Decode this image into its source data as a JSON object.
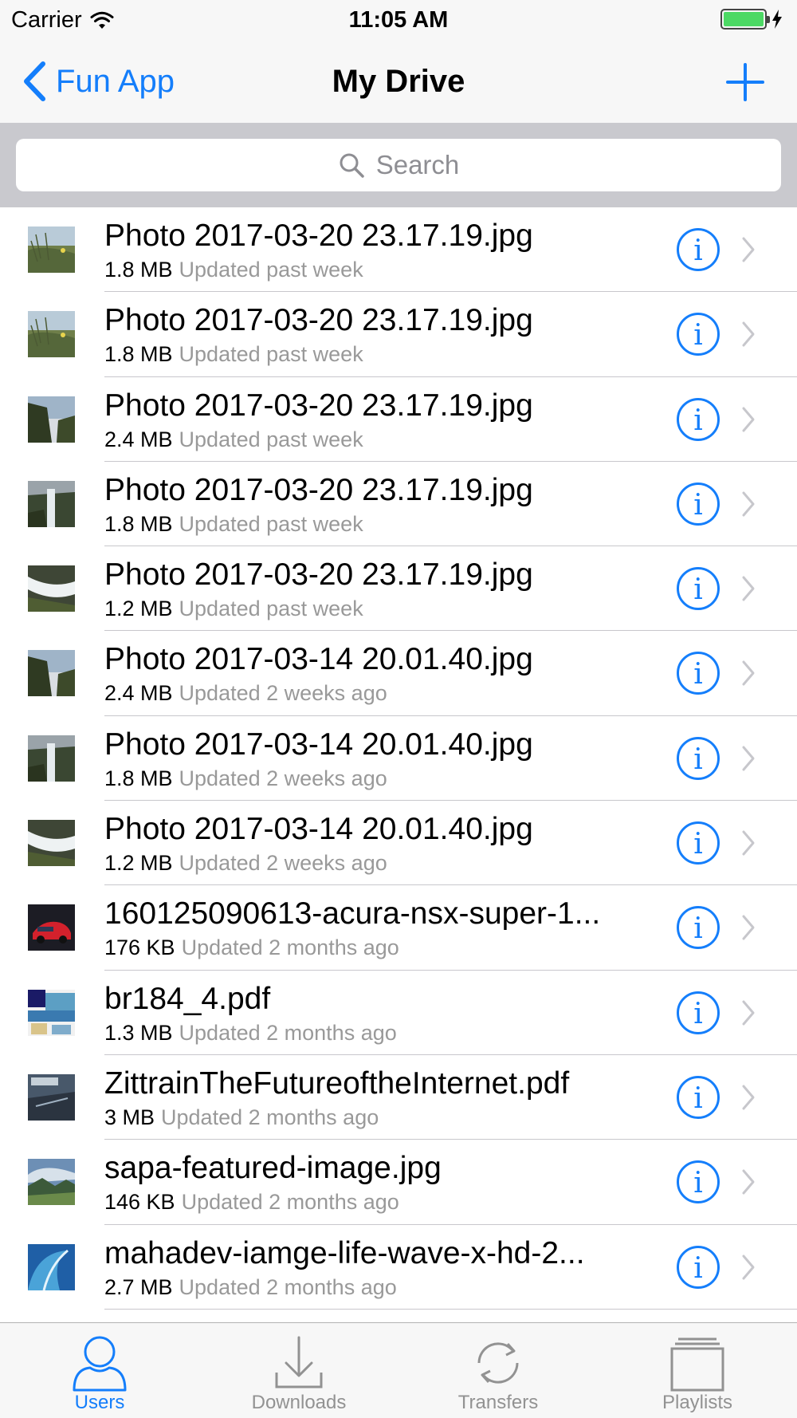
{
  "status_bar": {
    "carrier": "Carrier",
    "time": "11:05 AM"
  },
  "nav": {
    "back_label": "Fun App",
    "title": "My Drive"
  },
  "search": {
    "placeholder": "Search"
  },
  "files": [
    {
      "name": "Photo 2017-03-20 23.17.19.jpg",
      "size": "1.8 MB",
      "updated": "Updated past week",
      "thumb": "meadow"
    },
    {
      "name": "Photo 2017-03-20 23.17.19.jpg",
      "size": "1.8 MB",
      "updated": "Updated past week",
      "thumb": "meadow"
    },
    {
      "name": "Photo 2017-03-20 23.17.19.jpg",
      "size": "2.4 MB",
      "updated": "Updated past week",
      "thumb": "cliff"
    },
    {
      "name": "Photo 2017-03-20 23.17.19.jpg",
      "size": "1.8 MB",
      "updated": "Updated past week",
      "thumb": "waterfall"
    },
    {
      "name": "Photo 2017-03-20 23.17.19.jpg",
      "size": "1.2 MB",
      "updated": "Updated past week",
      "thumb": "stream"
    },
    {
      "name": "Photo 2017-03-14 20.01.40.jpg",
      "size": "2.4 MB",
      "updated": "Updated 2 weeks ago",
      "thumb": "cliff"
    },
    {
      "name": "Photo 2017-03-14 20.01.40.jpg",
      "size": "1.8 MB",
      "updated": "Updated 2 weeks ago",
      "thumb": "waterfall"
    },
    {
      "name": "Photo 2017-03-14 20.01.40.jpg",
      "size": "1.2 MB",
      "updated": "Updated 2 weeks ago",
      "thumb": "stream"
    },
    {
      "name": "160125090613-acura-nsx-super-1...",
      "size": "176 KB",
      "updated": "Updated 2 months ago",
      "thumb": "car"
    },
    {
      "name": "br184_4.pdf",
      "size": "1.3 MB",
      "updated": "Updated 2 months ago",
      "thumb": "pdf-brochure"
    },
    {
      "name": "ZittrainTheFutureoftheInternet.pdf",
      "size": "3 MB",
      "updated": "Updated 2 months ago",
      "thumb": "book-cover"
    },
    {
      "name": "sapa-featured-image.jpg",
      "size": "146 KB",
      "updated": "Updated 2 months ago",
      "thumb": "mountains"
    },
    {
      "name": "mahadev-iamge-life-wave-x-hd-2...",
      "size": "2.7 MB",
      "updated": "Updated 2 months ago",
      "thumb": "wave"
    }
  ],
  "tabs": [
    {
      "label": "Users",
      "icon": "user-icon",
      "active": true
    },
    {
      "label": "Downloads",
      "icon": "download-icon",
      "active": false
    },
    {
      "label": "Transfers",
      "icon": "sync-icon",
      "active": false
    },
    {
      "label": "Playlists",
      "icon": "playlist-icon",
      "active": false
    }
  ],
  "colors": {
    "accent": "#147efb",
    "battery": "#4cd964",
    "secondary_text": "#999999"
  }
}
